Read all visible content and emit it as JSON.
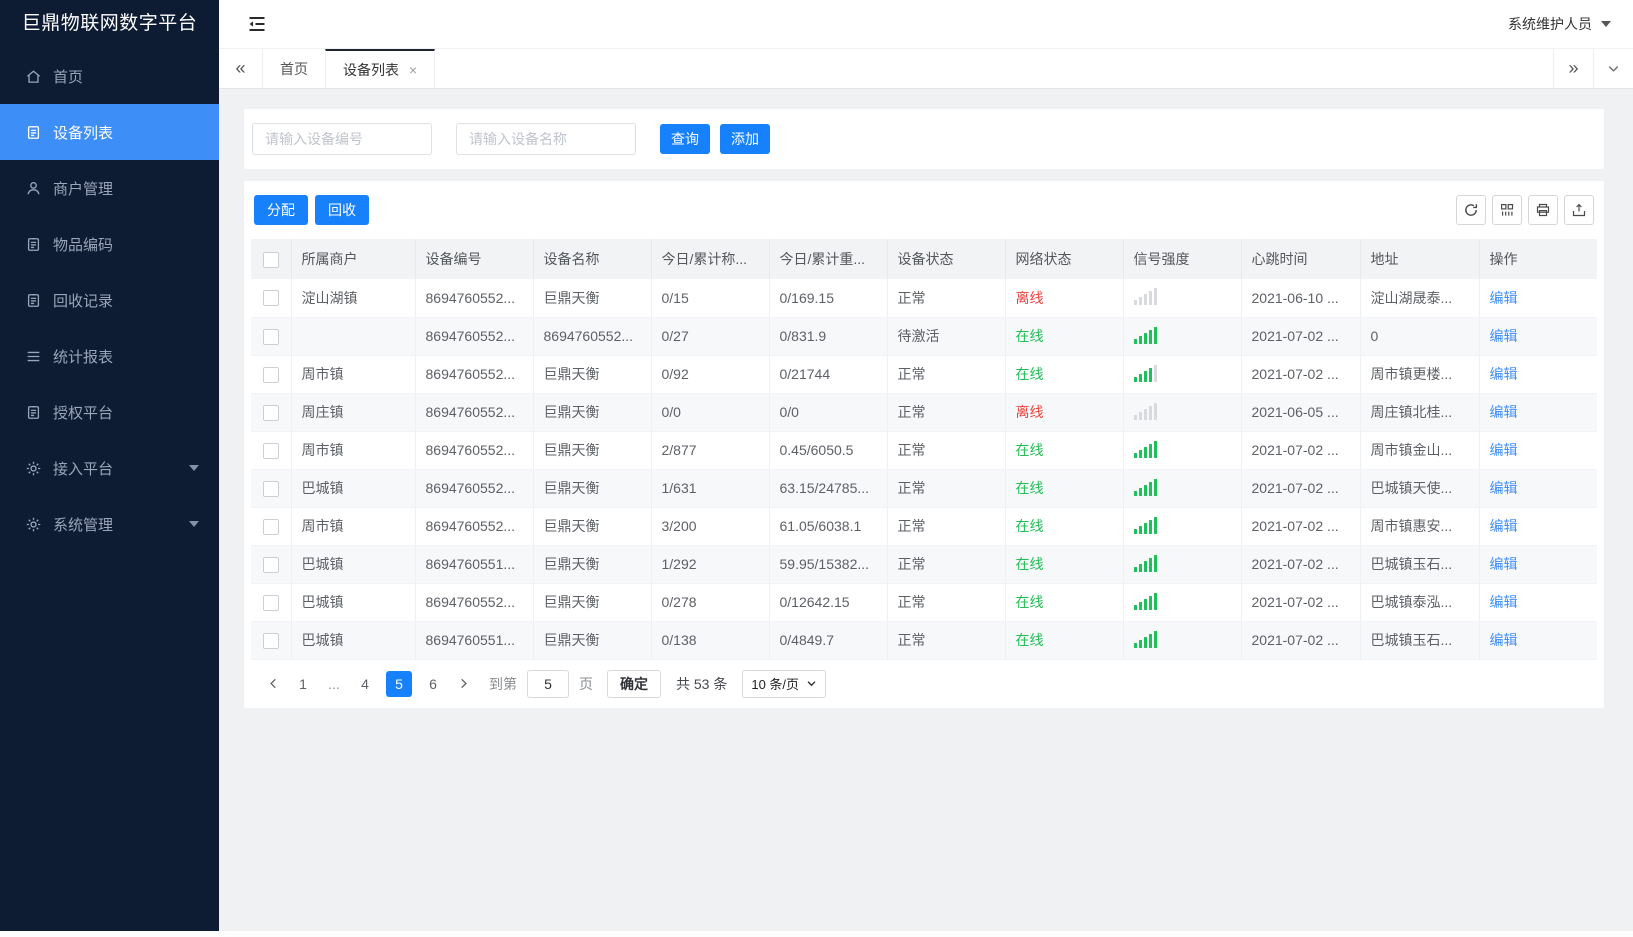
{
  "app": {
    "sidebar_title": "巨鼎物联网数字平台",
    "user_name": "系统维护人员"
  },
  "sidebar": {
    "items": [
      {
        "label": "首页",
        "icon": "home",
        "active": false,
        "expandable": false
      },
      {
        "label": "设备列表",
        "icon": "doc",
        "active": true,
        "expandable": false
      },
      {
        "label": "商户管理",
        "icon": "user",
        "active": false,
        "expandable": false
      },
      {
        "label": "物品编码",
        "icon": "doc",
        "active": false,
        "expandable": false
      },
      {
        "label": "回收记录",
        "icon": "doc",
        "active": false,
        "expandable": false
      },
      {
        "label": "统计报表",
        "icon": "menu",
        "active": false,
        "expandable": false
      },
      {
        "label": "授权平台",
        "icon": "doc",
        "active": false,
        "expandable": false
      },
      {
        "label": "接入平台",
        "icon": "gear",
        "active": false,
        "expandable": true
      },
      {
        "label": "系统管理",
        "icon": "gear",
        "active": false,
        "expandable": true
      }
    ]
  },
  "tabs": {
    "collapse_left": "«",
    "collapse_right": "»",
    "items": [
      {
        "label": "首页",
        "active": false
      },
      {
        "label": "设备列表",
        "active": true,
        "close_icon": "×"
      }
    ]
  },
  "search": {
    "device_no_placeholder": "请输入设备编号",
    "device_name_placeholder": "请输入设备名称",
    "query_label": "查询",
    "add_label": "添加"
  },
  "toolbar": {
    "assign_label": "分配",
    "recycle_label": "回收",
    "icons": [
      "refresh",
      "columns",
      "print",
      "export"
    ]
  },
  "table": {
    "columns": [
      "所属商户",
      "设备编号",
      "设备名称",
      "今日/累计称...",
      "今日/累计重...",
      "设备状态",
      "网络状态",
      "信号强度",
      "心跳时间",
      "地址",
      "操作"
    ],
    "action_label": "编辑",
    "rows": [
      {
        "merchant": "淀山湖镇",
        "device_no": "8694760552...",
        "device_name": "巨鼎天衡",
        "today_count": "0/15",
        "today_weight": "0/169.15",
        "device_status": "正常",
        "network_status": "离线",
        "online": false,
        "signal": 0,
        "heartbeat": "2021-06-10 ...",
        "address": "淀山湖晟泰..."
      },
      {
        "merchant": "",
        "device_no": "8694760552...",
        "device_name": "8694760552...",
        "today_count": "0/27",
        "today_weight": "0/831.9",
        "device_status": "待激活",
        "network_status": "在线",
        "online": true,
        "signal": 5,
        "heartbeat": "2021-07-02 ...",
        "address": "0"
      },
      {
        "merchant": "周市镇",
        "device_no": "8694760552...",
        "device_name": "巨鼎天衡",
        "today_count": "0/92",
        "today_weight": "0/21744",
        "device_status": "正常",
        "network_status": "在线",
        "online": true,
        "signal": 4,
        "heartbeat": "2021-07-02 ...",
        "address": "周市镇更楼..."
      },
      {
        "merchant": "周庄镇",
        "device_no": "8694760552...",
        "device_name": "巨鼎天衡",
        "today_count": "0/0",
        "today_weight": "0/0",
        "device_status": "正常",
        "network_status": "离线",
        "online": false,
        "signal": 0,
        "heartbeat": "2021-06-05 ...",
        "address": "周庄镇北桂..."
      },
      {
        "merchant": "周市镇",
        "device_no": "8694760552...",
        "device_name": "巨鼎天衡",
        "today_count": "2/877",
        "today_weight": "0.45/6050.5",
        "device_status": "正常",
        "network_status": "在线",
        "online": true,
        "signal": 5,
        "heartbeat": "2021-07-02 ...",
        "address": "周市镇金山..."
      },
      {
        "merchant": "巴城镇",
        "device_no": "8694760552...",
        "device_name": "巨鼎天衡",
        "today_count": "1/631",
        "today_weight": "63.15/24785...",
        "device_status": "正常",
        "network_status": "在线",
        "online": true,
        "signal": 5,
        "heartbeat": "2021-07-02 ...",
        "address": "巴城镇天使..."
      },
      {
        "merchant": "周市镇",
        "device_no": "8694760552...",
        "device_name": "巨鼎天衡",
        "today_count": "3/200",
        "today_weight": "61.05/6038.1",
        "device_status": "正常",
        "network_status": "在线",
        "online": true,
        "signal": 5,
        "heartbeat": "2021-07-02 ...",
        "address": "周市镇惠安..."
      },
      {
        "merchant": "巴城镇",
        "device_no": "8694760551...",
        "device_name": "巨鼎天衡",
        "today_count": "1/292",
        "today_weight": "59.95/15382...",
        "device_status": "正常",
        "network_status": "在线",
        "online": true,
        "signal": 5,
        "heartbeat": "2021-07-02 ...",
        "address": "巴城镇玉石..."
      },
      {
        "merchant": "巴城镇",
        "device_no": "8694760552...",
        "device_name": "巨鼎天衡",
        "today_count": "0/278",
        "today_weight": "0/12642.15",
        "device_status": "正常",
        "network_status": "在线",
        "online": true,
        "signal": 5,
        "heartbeat": "2021-07-02 ...",
        "address": "巴城镇泰泓..."
      },
      {
        "merchant": "巴城镇",
        "device_no": "8694760551...",
        "device_name": "巨鼎天衡",
        "today_count": "0/138",
        "today_weight": "0/4849.7",
        "device_status": "正常",
        "network_status": "在线",
        "online": true,
        "signal": 5,
        "heartbeat": "2021-07-02 ...",
        "address": "巴城镇玉石..."
      }
    ]
  },
  "pagination": {
    "pages": [
      "1",
      "...",
      "4",
      "5",
      "6"
    ],
    "active_page": "5",
    "goto_label": "到第",
    "goto_value": "5",
    "goto_unit": "页",
    "confirm_label": "确定",
    "total_label": "共 53 条",
    "page_size": "10 条/页"
  },
  "colors": {
    "accent_blue": "#1681fb",
    "sidebar_active_blue": "#3e8ef7",
    "online_green": "#21bd55",
    "offline_red": "#e8433c",
    "link_blue": "#3e8ef7",
    "sidebar_bg": "#0d1b33"
  }
}
